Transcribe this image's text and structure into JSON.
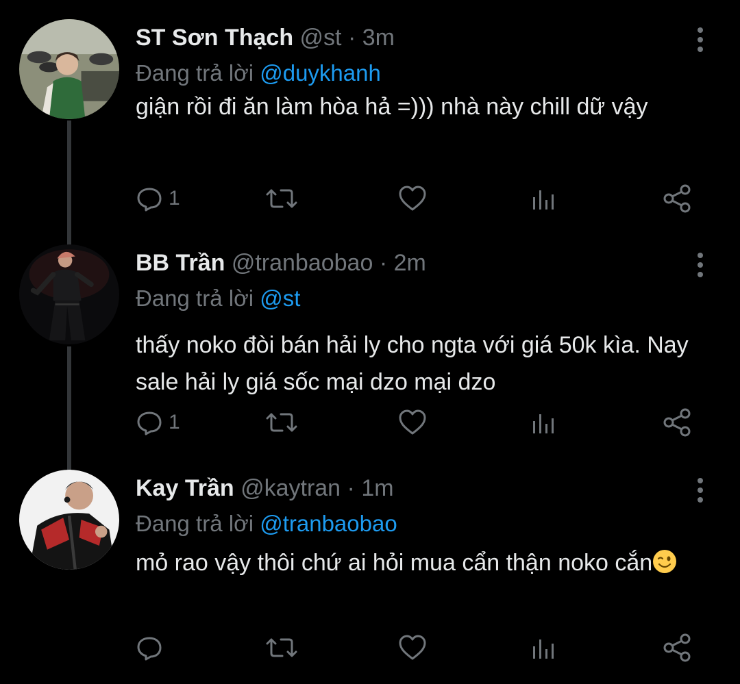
{
  "replying_label": "Đang trả lời",
  "tweets": [
    {
      "name": "ST Sơn Thạch",
      "handle": "@st",
      "dot": " · ",
      "time": "3m",
      "reply_to": "@duykhanh",
      "text": "giận rồi đi ăn làm hòa hả =))) nhà này chill dữ vậy",
      "reply_count": "1",
      "avatar_icon": "avatar-photo-icon"
    },
    {
      "name": "BB Trần",
      "handle": "@tranbaobao",
      "dot": " · ",
      "time": "2m",
      "reply_to": "@st",
      "text": "thấy noko đòi bán hải ly cho ngta với giá 50k kìa. Nay sale hải ly giá sốc mại dzo mại dzo",
      "reply_count": "1",
      "avatar_icon": "avatar-photo-icon"
    },
    {
      "name": "Kay Trần",
      "handle": "@kaytran",
      "dot": " · ",
      "time": "1m",
      "reply_to": "@tranbaobao",
      "text": "mỏ rao vậy thôi chứ ai hỏi mua cẩn thận noko cắn",
      "emoji": "winking-face-emoji",
      "reply_count": "",
      "avatar_icon": "avatar-photo-icon"
    }
  ],
  "colors": {
    "background": "#000000",
    "text": "#e7e9ea",
    "secondary": "#71767b",
    "link": "#1d9bf0",
    "thread_line": "#333639"
  }
}
